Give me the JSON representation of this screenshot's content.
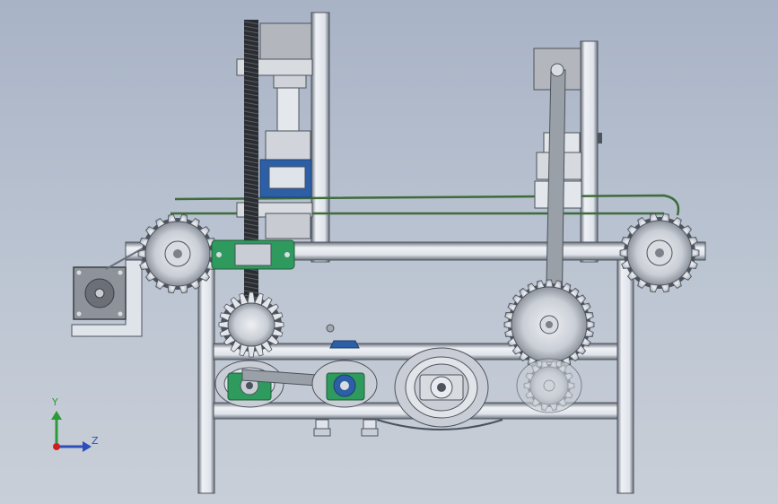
{
  "viewport": {
    "background_top": "#a8b3c6",
    "background_bottom": "#c9cfd8"
  },
  "triad": {
    "y_label": "Y",
    "z_label": "Z",
    "y_color": "#2d9a3a",
    "z_color": "#2d4db8",
    "origin_color": "#d11f1f"
  },
  "colors": {
    "frame": "#dfe3ea",
    "frame_dark": "#6a717c",
    "gear": "#c9ced6",
    "gear_dark": "#4d535c",
    "bearing_green": "#2f9a5e",
    "motor_block": "#b3b7bd",
    "belt": "#3e6b3a",
    "lead_screw": "#2a2d31",
    "blue_housing": "#2c5fa6"
  }
}
